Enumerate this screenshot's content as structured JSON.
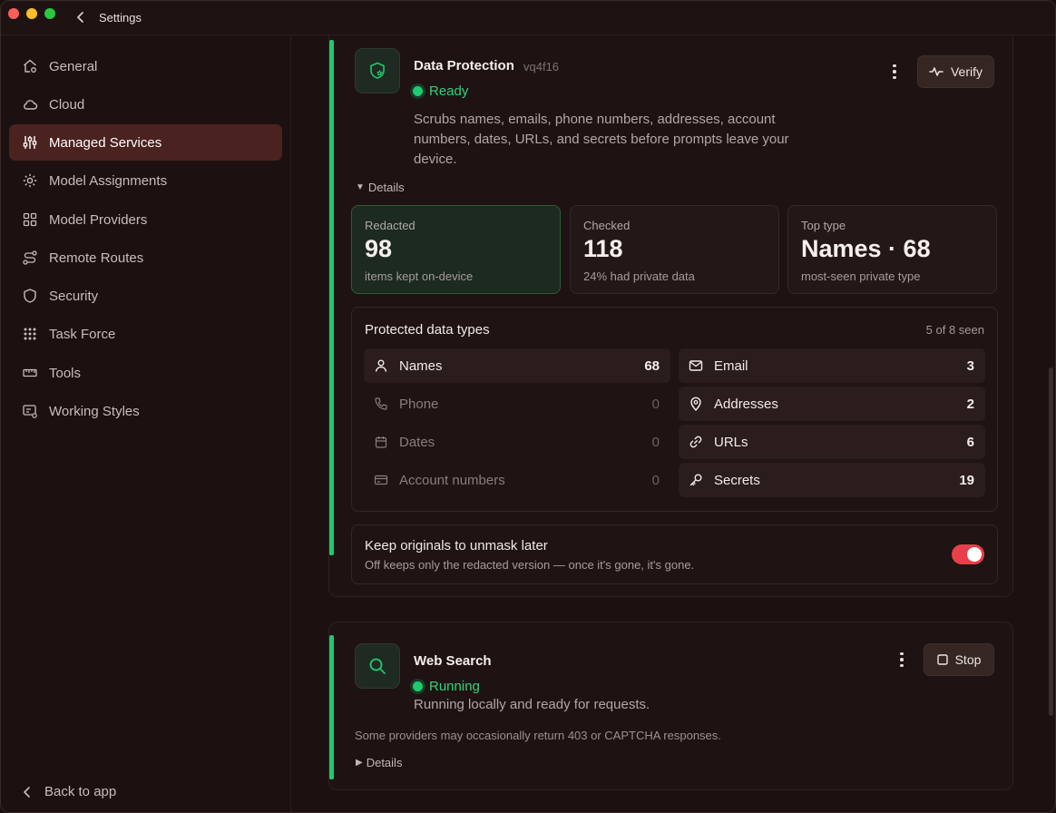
{
  "window": {
    "title": "Settings"
  },
  "sidebar": {
    "items": [
      {
        "label": "General",
        "icon": "home-gear-icon",
        "active": false
      },
      {
        "label": "Cloud",
        "icon": "cloud-icon",
        "active": false
      },
      {
        "label": "Managed Services",
        "icon": "sliders-icon",
        "active": true
      },
      {
        "label": "Model Assignments",
        "icon": "cog-icon",
        "active": false
      },
      {
        "label": "Model Providers",
        "icon": "grid-icon",
        "active": false
      },
      {
        "label": "Remote Routes",
        "icon": "route-icon",
        "active": false
      },
      {
        "label": "Security",
        "icon": "shield-icon",
        "active": false
      },
      {
        "label": "Task Force",
        "icon": "dots-grid-icon",
        "active": false
      },
      {
        "label": "Tools",
        "icon": "ruler-icon",
        "active": false
      },
      {
        "label": "Working Styles",
        "icon": "style-icon",
        "active": false
      }
    ],
    "back_label": "Back to app"
  },
  "data_protection": {
    "name": "Data Protection",
    "id": "vq4f16",
    "status": "Ready",
    "description": "Scrubs names, emails, phone numbers, addresses, account numbers, dates, URLs, and secrets before prompts leave your device.",
    "verify_label": "Verify",
    "details_label": "Details",
    "stats": [
      {
        "label": "Redacted",
        "value": "98",
        "sub": "items kept on-device"
      },
      {
        "label": "Checked",
        "value": "118",
        "sub": "24% had private data"
      },
      {
        "label": "Top type",
        "value": "Names · 68",
        "sub": "most-seen private type"
      }
    ],
    "types_panel": {
      "title": "Protected data types",
      "meta": "5 of 8 seen",
      "left": [
        {
          "name": "Names",
          "count": "68",
          "icon": "person-icon",
          "on": true
        },
        {
          "name": "Phone",
          "count": "0",
          "icon": "phone-icon",
          "on": false
        },
        {
          "name": "Dates",
          "count": "0",
          "icon": "calendar-icon",
          "on": false
        },
        {
          "name": "Account numbers",
          "count": "0",
          "icon": "card-icon",
          "on": false
        }
      ],
      "right": [
        {
          "name": "Email",
          "count": "3",
          "icon": "mail-icon",
          "on": true
        },
        {
          "name": "Addresses",
          "count": "2",
          "icon": "pin-icon",
          "on": true
        },
        {
          "name": "URLs",
          "count": "6",
          "icon": "link-icon",
          "on": true
        },
        {
          "name": "Secrets",
          "count": "19",
          "icon": "key-icon",
          "on": true
        }
      ]
    },
    "keep_originals": {
      "title": "Keep originals to unmask later",
      "subtitle": "Off keeps only the redacted version — once it's gone, it's gone.",
      "enabled": true
    }
  },
  "web_search": {
    "name": "Web Search",
    "status": "Running",
    "description": "Running locally and ready for requests.",
    "stop_label": "Stop",
    "note": "Some providers may occasionally return 403 or CAPTCHA responses.",
    "details_label": "Details"
  },
  "colors": {
    "accent": "#1fc971",
    "active_nav": "#4a2220",
    "toggle": "#e8404a"
  }
}
